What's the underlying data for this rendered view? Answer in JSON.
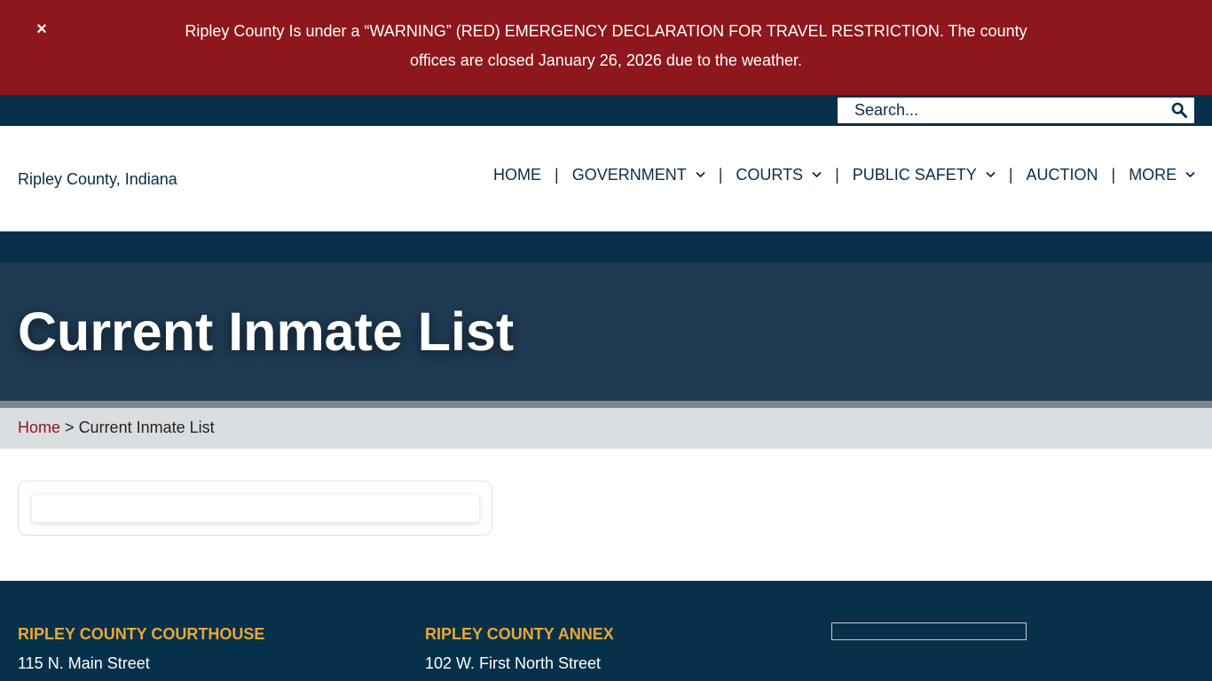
{
  "alert": {
    "close_label": "×",
    "message": "Ripley County Is under a “WARNING” (RED) EMERGENCY DECLARATION FOR TRAVEL RESTRICTION. The county offices are closed January 26, 2026 due to the weather."
  },
  "search": {
    "placeholder": "Search..."
  },
  "logo": {
    "alt": "Ripley County, Indiana"
  },
  "nav": {
    "separator": "|",
    "items": [
      {
        "label": "HOME"
      },
      {
        "label": "GOVERNMENT"
      },
      {
        "label": "COURTS"
      },
      {
        "label": "PUBLIC SAFETY"
      },
      {
        "label": "AUCTION"
      },
      {
        "label": "MORE"
      }
    ]
  },
  "page": {
    "title": "Current Inmate List"
  },
  "breadcrumb": {
    "home": "Home",
    "separator": ">",
    "current": "Current Inmate List"
  },
  "footer": {
    "columns": [
      {
        "heading": "RIPLEY COUNTY COURTHOUSE",
        "line1": "115 N. Main Street"
      },
      {
        "heading": "RIPLEY COUNTY ANNEX",
        "line1": "102 W. First North Street"
      }
    ]
  },
  "colors": {
    "alert_red": "#8d171c",
    "navy": "#07304a",
    "hero_blue": "#1f3a52",
    "footer_heading": "#e8a736",
    "link_red": "#8d171c"
  },
  "icons": {
    "close": "close-icon",
    "search": "search-icon",
    "dropdown": "chevron-down-icon"
  }
}
